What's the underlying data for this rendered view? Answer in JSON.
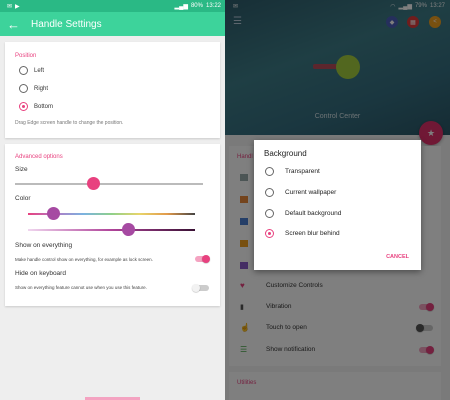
{
  "left_status": {
    "battery": "80%",
    "time": "13:22"
  },
  "app_bar": {
    "title": "Handle Settings"
  },
  "position": {
    "title": "Position",
    "options": [
      "Left",
      "Right",
      "Bottom"
    ],
    "selected": "Bottom",
    "hint": "Drag Edge screen handle to change the position."
  },
  "advanced": {
    "title": "Advanced options",
    "size_label": "Size",
    "size_value": 0.42,
    "color_label": "Color",
    "hue_value": 0.15,
    "shade_value": 0.6,
    "show_on_everything": {
      "label": "Show on everything",
      "sub": "Make handle control show on everything, for example as lock screen.",
      "enabled": true
    },
    "hide_on_keyboard": {
      "label": "Hide on keyboard",
      "sub": "Show on everything feature cannot use when you use this feature.",
      "enabled": false
    }
  },
  "right_status": {
    "battery": "79%",
    "time": "13:27"
  },
  "header": {
    "title": "Control Center"
  },
  "list": {
    "section_partial": "Handl",
    "items": [
      {
        "label": "Customize Controls",
        "icon": "heart-icon"
      },
      {
        "label": "Vibration",
        "icon": "vibration-icon",
        "enabled": true
      },
      {
        "label": "Touch to open",
        "icon": "touch-icon",
        "enabled": false
      },
      {
        "label": "Show notification",
        "icon": "list-icon",
        "enabled": true
      }
    ],
    "utilities": "Utilities"
  },
  "dialog": {
    "title": "Background",
    "options": [
      "Transparent",
      "Current wallpaper",
      "Default background",
      "Screen blur behind"
    ],
    "selected": "Screen blur behind",
    "cancel": "CANCEL"
  },
  "colors": {
    "accent": "#e8417f",
    "app_bar": "#3dd39b",
    "status_bar": "#2ab985"
  }
}
